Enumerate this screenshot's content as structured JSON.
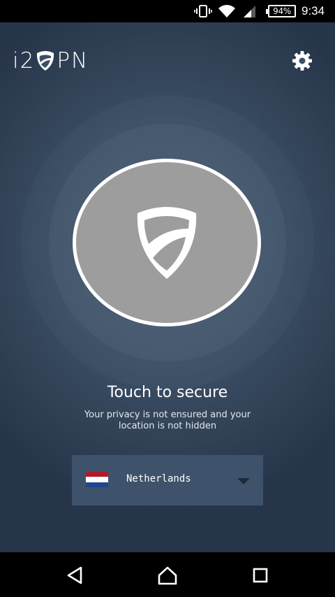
{
  "status_bar": {
    "icons": [
      "vibrate-icon",
      "wifi-icon",
      "signal-icon",
      "battery-icon"
    ],
    "battery_percent": "94%",
    "time": "9:34"
  },
  "header": {
    "logo_prefix": "i2",
    "logo_suffix": "PN",
    "logo_icon": "shield-icon",
    "settings_icon": "gear-icon"
  },
  "main": {
    "connect_icon": "shield-icon",
    "title": "Touch to secure",
    "subtitle": "Your privacy is not ensured and your location is not hidden"
  },
  "country_selector": {
    "selected_country": "Netherlands",
    "flag_colors": [
      "#ae1c28",
      "#ffffff",
      "#21468b"
    ],
    "icon": "dropdown-arrow-icon"
  },
  "nav_bar": {
    "icons": [
      "back-icon",
      "home-icon",
      "recents-icon"
    ]
  },
  "colors": {
    "background": "#3c4f66",
    "button_fill": "#9d9d9d",
    "button_border": "#ffffff",
    "selector_bg": "#3e536b"
  }
}
